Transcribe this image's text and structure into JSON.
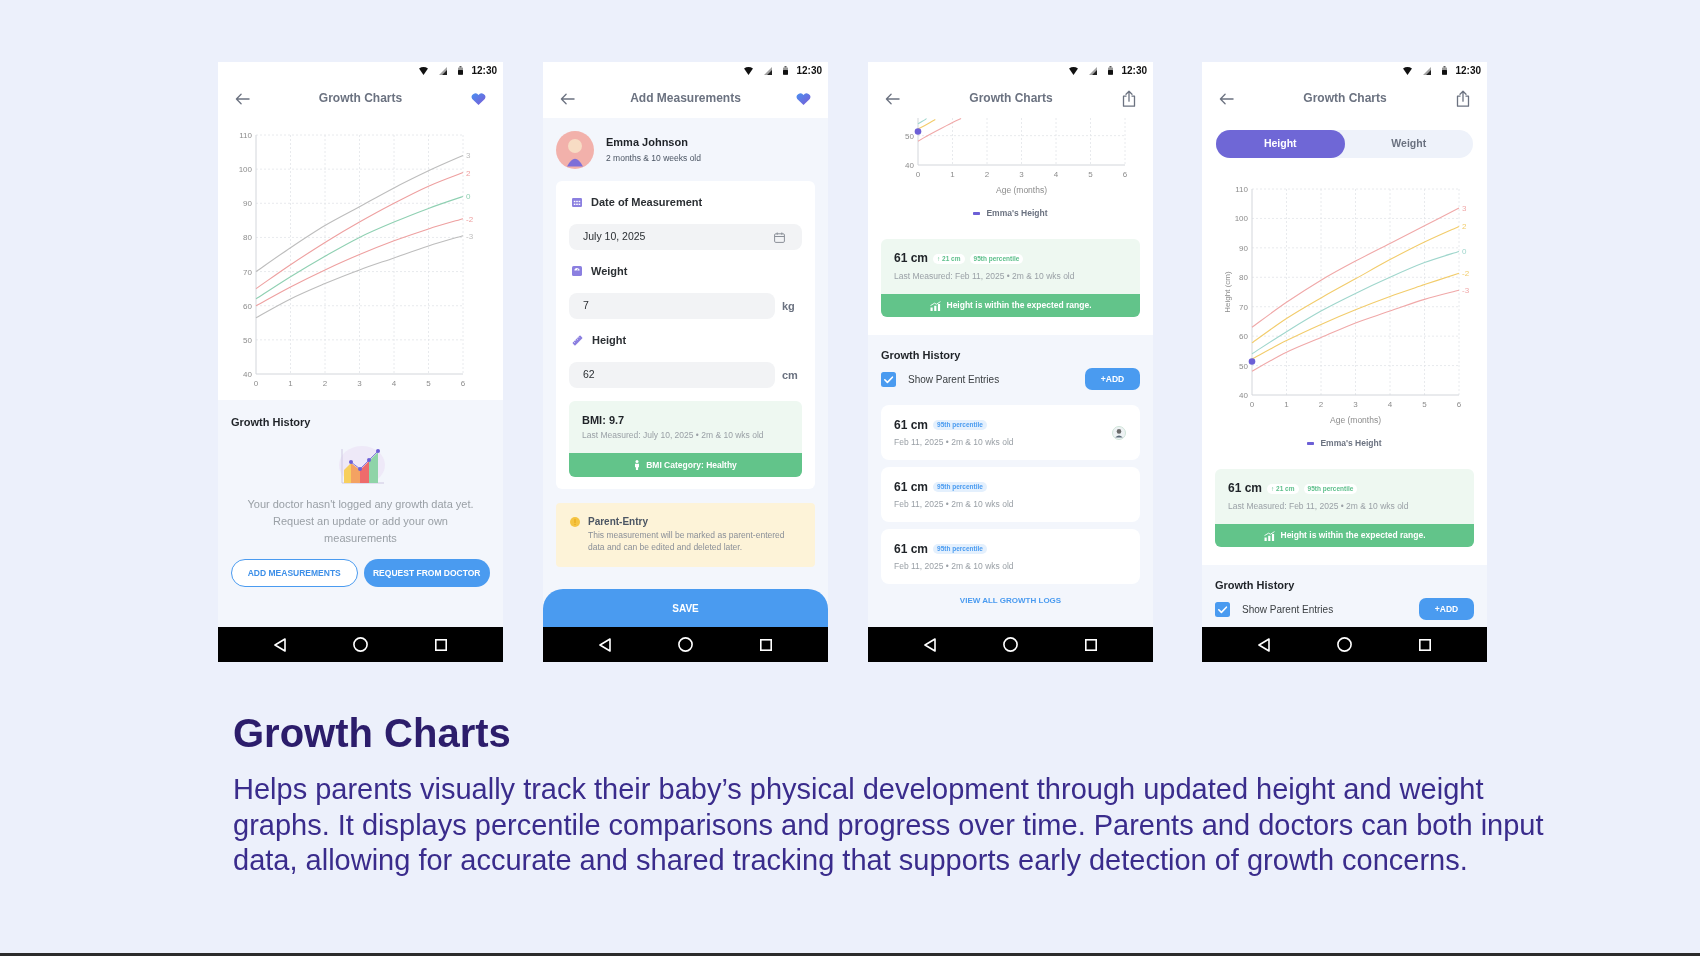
{
  "screens": [
    {
      "status_bar": {
        "time": "12:30"
      },
      "header": {
        "title": "Growth Charts",
        "action": {
          "kind": "favorite"
        }
      },
      "sections": [
        {
          "kind": "chart",
          "chart_data": {
            "type": "line",
            "grid": true,
            "x": [
              0,
              1,
              2,
              3,
              4,
              5,
              6
            ],
            "xlim": [
              0,
              6
            ],
            "xticks": [
              0,
              1,
              2,
              3,
              4,
              5,
              6
            ],
            "ylim": [
              40,
              110
            ],
            "yticks": [
              40,
              50,
              60,
              70,
              80,
              90,
              100,
              110
            ],
            "series": [
              {
                "name": "3",
                "color": "#bdbdbd",
                "values": [
                  70,
                  77,
                  83.5,
                  89,
                  94.5,
                  99.5,
                  104
                ]
              },
              {
                "name": "2",
                "color": "#eea0a0",
                "values": [
                  65,
                  72,
                  78.5,
                  84.5,
                  90,
                  95,
                  99
                ]
              },
              {
                "name": "0",
                "color": "#8fd0b2",
                "values": [
                  62,
                  68.5,
                  74.5,
                  80,
                  84.5,
                  88.5,
                  92
                ]
              },
              {
                "name": "-2",
                "color": "#eea0a0",
                "values": [
                  60,
                  65.5,
                  70.5,
                  75,
                  79,
                  82.5,
                  85.5
                ]
              },
              {
                "name": "-3",
                "color": "#bdbdbd",
                "values": [
                  56.5,
                  62,
                  66.5,
                  70.5,
                  74,
                  77.5,
                  80.5
                ]
              }
            ]
          }
        },
        {
          "kind": "empty_history",
          "title": "Growth History",
          "message": "Your doctor hasn't logged any growth data yet. Request an update or add your own measurements",
          "buttons": [
            {
              "label": "ADD MEASUREMENTS",
              "kind": "outline"
            },
            {
              "label": "REQUEST FROM DOCTOR",
              "kind": "filled"
            }
          ]
        }
      ]
    },
    {
      "status_bar": {
        "time": "12:30"
      },
      "header": {
        "title": "Add Measurements",
        "action": {
          "kind": "favorite"
        }
      },
      "sections": [
        {
          "kind": "profile",
          "name": "Emma Johnson",
          "age": "2 months & 10 weeks old"
        },
        {
          "kind": "form",
          "fields": [
            {
              "kind": "date",
              "label": "Date of Measurement",
              "value": "July 10, 2025"
            },
            {
              "kind": "weight",
              "label": "Weight",
              "value": "7",
              "unit": "kg"
            },
            {
              "kind": "height",
              "label": "Height",
              "value": "62",
              "unit": "cm"
            }
          ],
          "result": {
            "title": "BMI: 9.7",
            "detail": "Last Measured: July 10, 2025 • 2m & 10 wks old",
            "status": "BMI Category: Healthy"
          }
        },
        {
          "kind": "notice",
          "title": "Parent-Entry",
          "text": "This measurement will be marked as parent-entered data and can be edited and deleted later."
        },
        {
          "kind": "save",
          "label": "SAVE"
        }
      ]
    },
    {
      "status_bar": {
        "time": "12:30"
      },
      "header": {
        "title": "Growth Charts",
        "action": {
          "kind": "share"
        }
      },
      "sections": [
        {
          "kind": "chart",
          "chart_data": {
            "type": "line",
            "grid": true,
            "xlabel": "Age (months)",
            "x": [
              0,
              0.25,
              0.5,
              1,
              1.25
            ],
            "xlim": [
              0,
              6
            ],
            "xticks": [
              0,
              1,
              2,
              3,
              4,
              5,
              6
            ],
            "ylim": [
              40,
              56
            ],
            "yticks": [
              40,
              50
            ],
            "series": [
              {
                "color": "#9fd6cc",
                "values": [
                  54,
                  55.8,
                  null,
                  null,
                  null
                ]
              },
              {
                "color": "#f2cc6b",
                "values": [
                  52.2,
                  53.8,
                  55.5,
                  null,
                  null
                ]
              },
              {
                "color": "#f0a8a8",
                "values": [
                  48.1,
                  49.8,
                  51.4,
                  54.5,
                  55.8
                ]
              },
              {
                "name": "Emma's Height",
                "color": "#6c5fd6",
                "marker": "circle",
                "values": [
                  51.4,
                  null,
                  null,
                  null,
                  null
                ]
              }
            ]
          }
        },
        {
          "kind": "summary",
          "value": "61 cm",
          "change": "↑ 21 cm",
          "percentile": "95th percentile",
          "detail": "Last Measured: Feb 11, 2025 • 2m & 10 wks old",
          "status": "Height is within the expected range."
        },
        {
          "kind": "history",
          "title": "Growth History",
          "filter": {
            "label": "Show Parent Entries",
            "checked": true
          },
          "add_button": "+ADD",
          "entries": [
            {
              "value": "61 cm",
              "percentile": "95th percentile",
              "detail": "Feb 11, 2025 • 2m & 10 wks old",
              "avatar": true
            },
            {
              "value": "61 cm",
              "percentile": "95th percentile",
              "detail": "Feb 11, 2025 • 2m & 10 wks old",
              "avatar": false
            },
            {
              "value": "61 cm",
              "percentile": "95th percentile",
              "detail": "Feb 11, 2025 • 2m & 10 wks old",
              "avatar": false
            }
          ],
          "link": "VIEW ALL GROWTH LOGS"
        }
      ]
    },
    {
      "status_bar": {
        "time": "12:30"
      },
      "header": {
        "title": "Growth Charts",
        "action": {
          "kind": "share"
        }
      },
      "sections": [
        {
          "kind": "tabs",
          "items": [
            {
              "label": "Height",
              "selected": true
            },
            {
              "label": "Weight",
              "selected": false
            }
          ]
        },
        {
          "kind": "chart",
          "chart_data": {
            "type": "line",
            "grid": true,
            "xlabel": "Age (months)",
            "ylabel": "Height (cm)",
            "x": [
              0,
              1,
              2,
              3,
              4,
              5,
              6
            ],
            "xlim": [
              0,
              6
            ],
            "xticks": [
              0,
              1,
              2,
              3,
              4,
              5,
              6
            ],
            "ylim": [
              40,
              110
            ],
            "yticks": [
              40,
              50,
              60,
              70,
              80,
              90,
              100,
              110
            ],
            "series": [
              {
                "name": "3",
                "color": "#f0a8a8",
                "values": [
                  63,
                  71.5,
                  79,
                  85.5,
                  91.5,
                  97.5,
                  103.5
                ]
              },
              {
                "name": "2",
                "color": "#f2cc6b",
                "values": [
                  57.7,
                  66,
                  73,
                  79.5,
                  86,
                  92,
                  97.3
                ]
              },
              {
                "name": "0",
                "color": "#9fd6cc",
                "values": [
                  54,
                  61.5,
                  68.5,
                  74.5,
                  80,
                  85,
                  88.8
                ]
              },
              {
                "name": "-2",
                "color": "#f2cc6b",
                "values": [
                  52.2,
                  58.5,
                  64,
                  69,
                  73.5,
                  77.5,
                  81.4
                ]
              },
              {
                "name": "-3",
                "color": "#f0a8a8",
                "values": [
                  48.1,
                  54.5,
                  59.5,
                  64.5,
                  68.5,
                  72.5,
                  75.6
                ]
              },
              {
                "name": "Emma's Height",
                "color": "#6c5fd6",
                "marker": "circle",
                "values": [
                  51.4,
                  null,
                  null,
                  null,
                  null,
                  null,
                  null
                ]
              }
            ]
          }
        },
        {
          "kind": "summary",
          "value": "61 cm",
          "change": "↑ 21 cm",
          "percentile": "95th percentile",
          "detail": "Last Measured: Feb 11, 2025 • 2m & 10 wks old",
          "status": "Height is within the expected range."
        },
        {
          "kind": "history",
          "title": "Growth History",
          "filter": {
            "label": "Show Parent Entries",
            "checked": true
          },
          "add_button": "+ADD"
        }
      ]
    }
  ],
  "feature": {
    "title": "Growth Charts",
    "description": "Helps parents visually track their baby’s physical development through updated height and weight graphs. It displays percentile comparisons and progress over time. Parents and doctors can both input data, allowing for accurate and shared tracking that supports early detection of growth concerns."
  }
}
